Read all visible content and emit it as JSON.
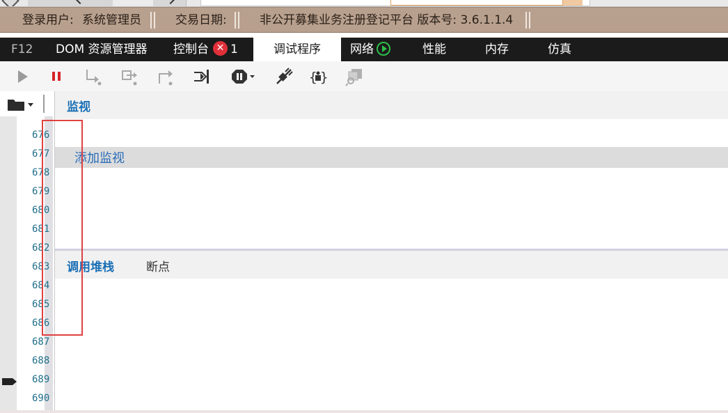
{
  "header": {
    "user_label": "登录用户:",
    "user_name": "系统管理员",
    "trade_date_label": "交易日期:",
    "platform": "非公开募集业务注册登记平台 版本号: 3.6.1.1.4"
  },
  "devtools": {
    "tabs": {
      "f12": "F12",
      "dom": "DOM 资源管理器",
      "console": "控制台",
      "console_errors": "1",
      "debugger": "调试程序",
      "network": "网络",
      "performance": "性能",
      "memory": "内存",
      "emulation": "仿真"
    },
    "active_tab": "调试程序",
    "toolbar_icons": [
      "play-icon",
      "pause-icon",
      "step-into-icon",
      "step-over-icon",
      "step-out-icon",
      "break-on-new-worker-icon",
      "exception-behavior-icon",
      "disconnect-icon",
      "pretty-print-icon",
      "just-my-code-icon"
    ],
    "line_numbers": [
      "676",
      "677",
      "678",
      "679",
      "680",
      "681",
      "682",
      "683",
      "684",
      "685",
      "686",
      "687",
      "688",
      "689",
      "690"
    ],
    "watch": {
      "title": "监视",
      "add_watch": "添加监视"
    },
    "callstack": {
      "title": "调用堆栈",
      "breakpoints": "断点"
    }
  },
  "colors": {
    "header_bg": "#b8a08e",
    "tabbar_bg": "#1b1b1b",
    "accent_blue": "#1a6fb5",
    "line_number": "#1f6e8a",
    "error_red": "#e0303a",
    "network_green": "#2fbf4a",
    "highlight_box": "#e04141"
  }
}
